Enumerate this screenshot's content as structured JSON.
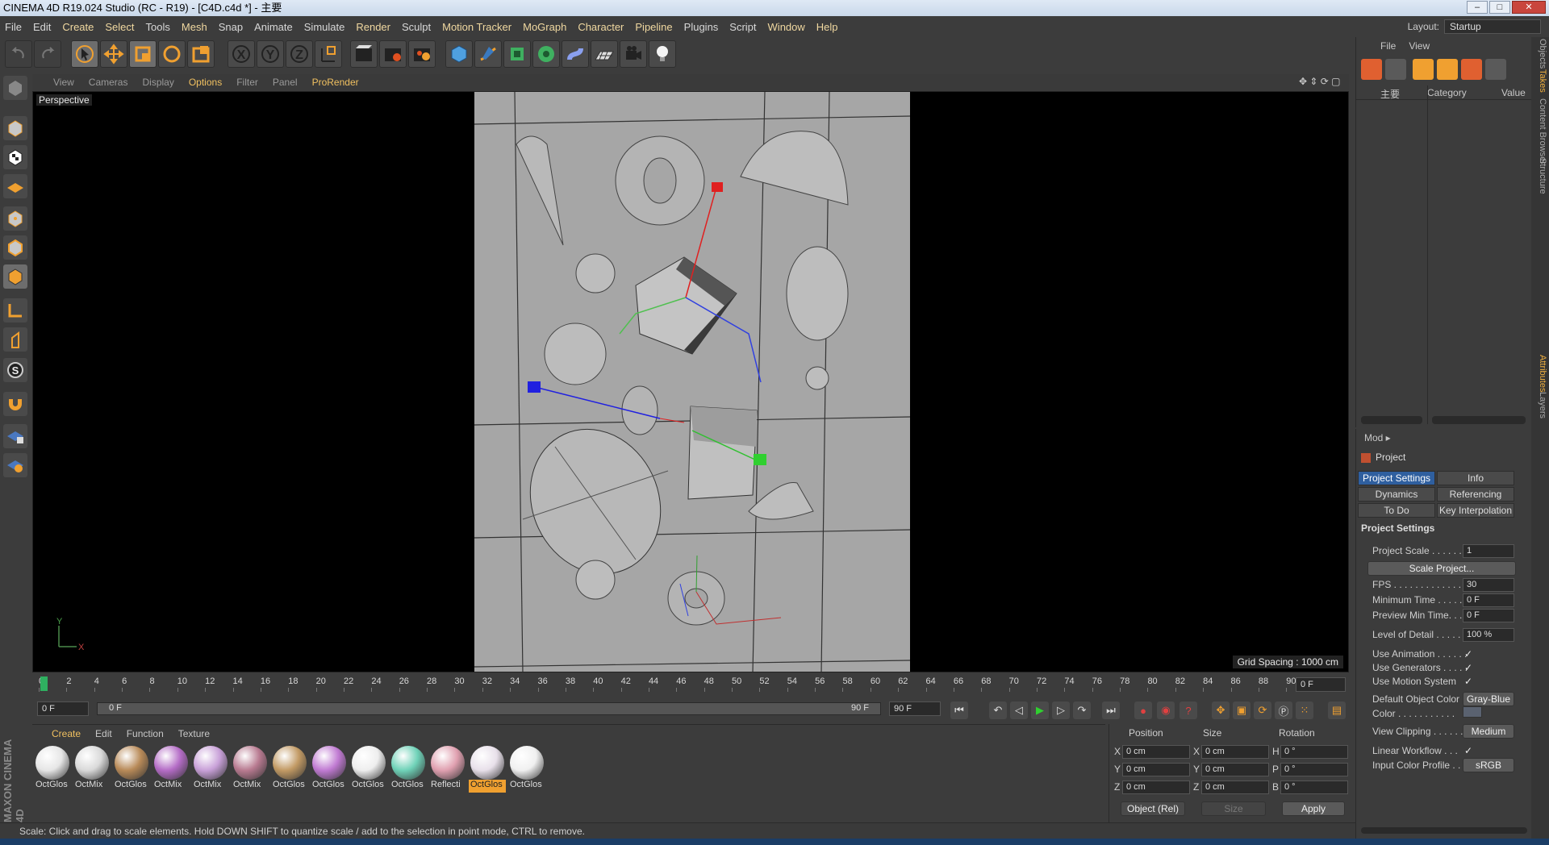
{
  "window": {
    "title": "CINEMA 4D R19.024 Studio (RC - R19) - [C4D.c4d *] - 主要"
  },
  "menubar": [
    "File",
    "Edit",
    "Create",
    "Select",
    "Tools",
    "Mesh",
    "Snap",
    "Animate",
    "Simulate",
    "Render",
    "Sculpt",
    "Motion Tracker",
    "MoGraph",
    "Character",
    "Pipeline",
    "Plugins",
    "Script",
    "Window",
    "Help"
  ],
  "layout": {
    "label": "Layout:",
    "value": "Startup"
  },
  "viewport": {
    "menu": [
      "View",
      "Cameras",
      "Display",
      "Options",
      "Filter",
      "Panel",
      "ProRender"
    ],
    "highlighted_menu": "Options",
    "camera_label": "Perspective",
    "grid_spacing": "Grid Spacing : 1000 cm",
    "axis_y": "Y",
    "axis_x": "X"
  },
  "timeline": {
    "ticks": [
      "0",
      "2",
      "4",
      "6",
      "8",
      "10",
      "12",
      "14",
      "16",
      "18",
      "20",
      "22",
      "24",
      "26",
      "28",
      "30",
      "32",
      "34",
      "36",
      "38",
      "40",
      "42",
      "44",
      "46",
      "48",
      "50",
      "52",
      "54",
      "56",
      "58",
      "60",
      "62",
      "64",
      "66",
      "68",
      "70",
      "72",
      "74",
      "76",
      "78",
      "80",
      "82",
      "84",
      "86",
      "88",
      "90"
    ],
    "current_frame": "0 F",
    "start_frame": "0 F",
    "range_start": "0 F",
    "range_end": "90 F",
    "end_frame": "90 F"
  },
  "materials": {
    "menu": [
      "Create",
      "Edit",
      "Function",
      "Texture"
    ],
    "items": [
      {
        "name": "OctGlos",
        "color": "#e6e6e6"
      },
      {
        "name": "OctMix",
        "color": "#d9d9d9"
      },
      {
        "name": "OctGlos",
        "color": "#b88a58"
      },
      {
        "name": "OctMix",
        "color": "#b46cc6"
      },
      {
        "name": "OctMix",
        "color": "#c8a0d8"
      },
      {
        "name": "OctMix",
        "color": "#b87a90"
      },
      {
        "name": "OctGlos",
        "color": "#c29a64"
      },
      {
        "name": "OctGlos",
        "color": "#c07ad2"
      },
      {
        "name": "OctGlos",
        "color": "#eeeeee"
      },
      {
        "name": "OctGlos",
        "color": "#6fd2b8"
      },
      {
        "name": "Reflecti",
        "color": "#e0a0b0"
      },
      {
        "name": "OctGlos",
        "color": "#e8e0ea"
      },
      {
        "name": "OctGlos",
        "color": "#f0f0f0"
      }
    ],
    "selected_index": 11
  },
  "coords": {
    "headers": [
      "Position",
      "Size",
      "Rotation"
    ],
    "rows": [
      {
        "axis": "X",
        "pos": "0 cm",
        "size_axis": "X",
        "size": "0 cm",
        "rot_axis": "H",
        "rot": "0 °"
      },
      {
        "axis": "Y",
        "pos": "0 cm",
        "size_axis": "Y",
        "size": "0 cm",
        "rot_axis": "P",
        "rot": "0 °"
      },
      {
        "axis": "Z",
        "pos": "0 cm",
        "size_axis": "Z",
        "size": "0 cm",
        "rot_axis": "B",
        "rot": "0 °"
      }
    ],
    "mode": "Object (Rel)",
    "size_mode": "Size",
    "apply": "Apply"
  },
  "status": "Scale: Click and drag to scale elements. Hold DOWN SHIFT to quantize scale / add to the selection in point mode, CTRL to remove.",
  "objects_panel": {
    "menu": [
      "File",
      "View"
    ],
    "col_name": "主要",
    "col_category": "Category",
    "col_value": "Value"
  },
  "attributes": {
    "mode": "Mod",
    "title": "Project",
    "tabs": [
      [
        "Project Settings",
        "Info"
      ],
      [
        "Dynamics",
        "Referencing"
      ],
      [
        "To Do",
        "Key Interpolation"
      ]
    ],
    "section": "Project Settings",
    "rows": [
      {
        "label": "Project Scale . . . . . . . .",
        "value": "1"
      },
      {
        "label": "FPS . . . . . . . . . . . . . . .",
        "value": "30"
      },
      {
        "label": "Minimum Time . . . . .",
        "value": "0 F"
      },
      {
        "label": "Preview Min Time. . . .",
        "value": "0 F"
      },
      {
        "label": "Level of Detail . . . . .",
        "value": "100 %"
      }
    ],
    "scale_button": "Scale Project...",
    "checks": [
      {
        "label": "Use Animation . . . . . .",
        "value": "✓"
      },
      {
        "label": "Use Generators . . . . .",
        "value": "✓"
      },
      {
        "label": "Use Motion System",
        "value": "✓"
      }
    ],
    "default_color_label": "Default Object Color",
    "default_color_value": "Gray-Blue",
    "color_label": "Color . . . . . . . . . . .",
    "view_clipping_label": "View Clipping . . . . . .",
    "view_clipping_value": "Medium",
    "linear_workflow_label": "Linear Workflow . . .",
    "linear_workflow_value": "✓",
    "input_color_label": "Input Color Profile . . .",
    "input_color_value": "sRGB"
  },
  "side_tabs": [
    "Objects",
    "Takes",
    "Content Browser",
    "Structure",
    "Attributes",
    "Layers"
  ],
  "brand": "MAXON CINEMA 4D"
}
